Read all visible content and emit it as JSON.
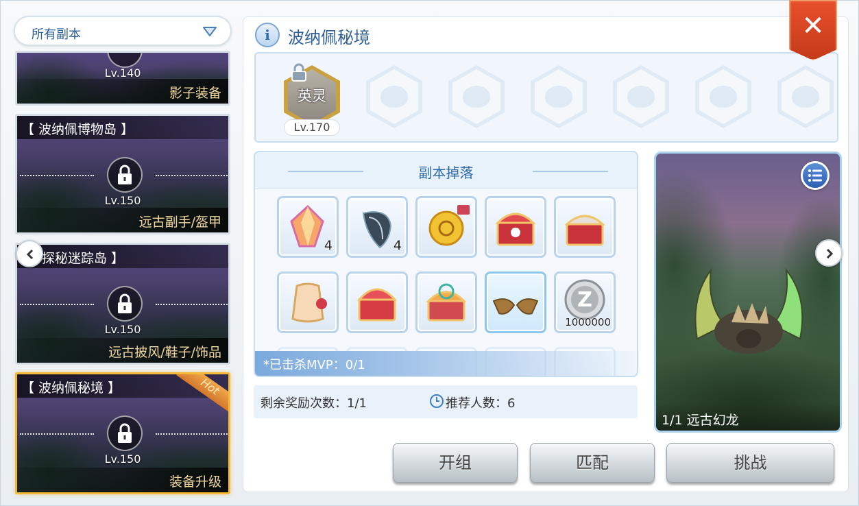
{
  "dropdown": {
    "label": "所有副本"
  },
  "cards": [
    {
      "name": "",
      "level": "Lv.140",
      "reward": "影子装备"
    },
    {
      "name": "【 波纳佩博物岛 】",
      "level": "Lv.150",
      "reward": "远古副手/盔甲"
    },
    {
      "name": "探秘迷踪岛 】",
      "level": "Lv.150",
      "reward": "远古披风/鞋子/饰品"
    },
    {
      "name": "【 波纳佩秘境 】",
      "level": "Lv.150",
      "reward": "装备升级",
      "badge": "Hot"
    }
  ],
  "header": {
    "title": "波纳佩秘境",
    "close_icon": "close-icon"
  },
  "modes": {
    "first_label": "英灵",
    "first_level": "Lv.170"
  },
  "drops": {
    "title": "副本掉落",
    "kill_status": "*已击杀MVP：0/1",
    "items": [
      {
        "icon": "crystal-icon",
        "qty": "4"
      },
      {
        "icon": "shell-icon",
        "qty": "4"
      },
      {
        "icon": "coin-icon",
        "qty": ""
      },
      {
        "icon": "treasure-chest-icon",
        "qty": ""
      },
      {
        "icon": "treasure-chest-icon",
        "qty": ""
      },
      {
        "icon": "cape-icon",
        "qty": ""
      },
      {
        "icon": "treasure-chest-icon",
        "qty": ""
      },
      {
        "icon": "treasure-chest-icon",
        "qty": ""
      },
      {
        "icon": "horns-icon",
        "qty": ""
      },
      {
        "icon": "zeny-coin-icon",
        "qty": "1000000"
      }
    ]
  },
  "info": {
    "remaining_rewards": "剩余奖励次数：1/1",
    "recommended_players": "推荐人数：6"
  },
  "boss": {
    "caption": "1/1 远古幻龙"
  },
  "buttons": {
    "team": "开组",
    "match": "匹配",
    "challenge": "挑战"
  },
  "colors": {
    "accent": "#2f6aa6",
    "close": "#d9441f",
    "active_border": "#f5b93a"
  }
}
